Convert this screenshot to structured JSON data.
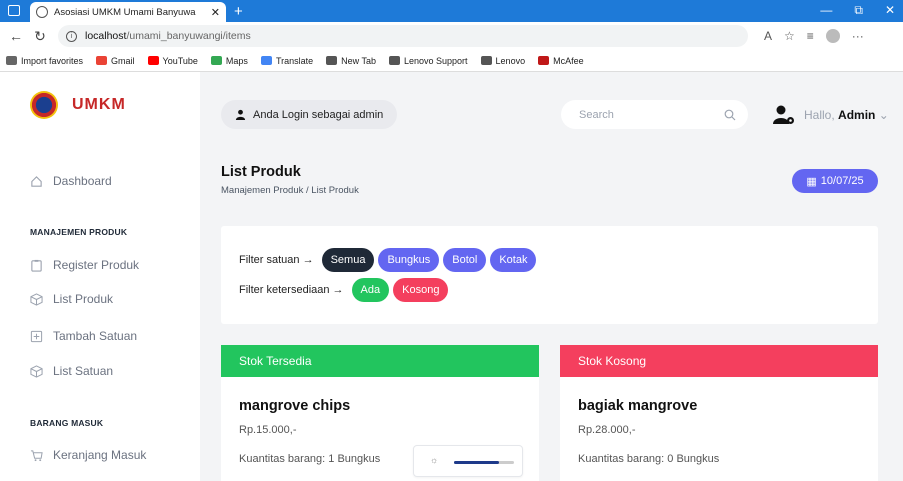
{
  "browser": {
    "tab_title": "Asosiasi UMKM Umami Banyuwa",
    "tab_close": "✕",
    "new_tab": "+",
    "url_host": "localhost",
    "url_path": "/umami_banyuwangi/items",
    "favorites": [
      {
        "label": "Import favorites",
        "color": "#666"
      },
      {
        "label": "Gmail",
        "color": "#ea4335"
      },
      {
        "label": "YouTube",
        "color": "#ff0000"
      },
      {
        "label": "Maps",
        "color": "#34a853"
      },
      {
        "label": "Translate",
        "color": "#4285f4"
      },
      {
        "label": "New Tab",
        "color": "#555"
      },
      {
        "label": "Lenovo Support",
        "color": "#555"
      },
      {
        "label": "Lenovo",
        "color": "#555"
      },
      {
        "label": "McAfee",
        "color": "#c01818"
      }
    ]
  },
  "sidebar": {
    "logo_text": "UMKM",
    "nav": {
      "dashboard": "Dashboard",
      "section_produk": "MANAJEMEN PRODUK",
      "register": "Register Produk",
      "list_produk": "List Produk",
      "tambah_satuan": "Tambah Satuan",
      "list_satuan": "List Satuan",
      "section_masuk": "BARANG MASUK",
      "keranjang": "Keranjang Masuk"
    }
  },
  "header": {
    "login_status": "Anda Login sebagai admin",
    "search_placeholder": "Search",
    "hallo": "Hallo,",
    "username": "Admin"
  },
  "page": {
    "title": "List Produk",
    "breadcrumb": "Manajemen Produk / List Produk",
    "date": "10/07/25"
  },
  "filters": {
    "satuan_label": "Filter satuan →",
    "satuan_options": [
      {
        "label": "Semua",
        "color": "#1f2937"
      },
      {
        "label": "Bungkus",
        "color": "#6366f1"
      },
      {
        "label": "Botol",
        "color": "#6366f1"
      },
      {
        "label": "Kotak",
        "color": "#6366f1"
      }
    ],
    "ketersediaan_label": "Filter ketersediaan →",
    "ketersediaan_options": [
      {
        "label": "Ada",
        "color": "#22c55e"
      },
      {
        "label": "Kosong",
        "color": "#f43f5e"
      }
    ]
  },
  "stock_cards": [
    {
      "header": "Stok Tersedia",
      "header_color": "#22c55e",
      "name": "mangrove chips",
      "price": "Rp.15.000,-",
      "quantity": "Kuantitas barang: 1 Bungkus",
      "slider_level": 0.75
    },
    {
      "header": "Stok Kosong",
      "header_color": "#f43f5e",
      "name": "bagiak mangrove",
      "price": "Rp.28.000,-",
      "quantity": "Kuantitas barang: 0 Bungkus"
    }
  ]
}
